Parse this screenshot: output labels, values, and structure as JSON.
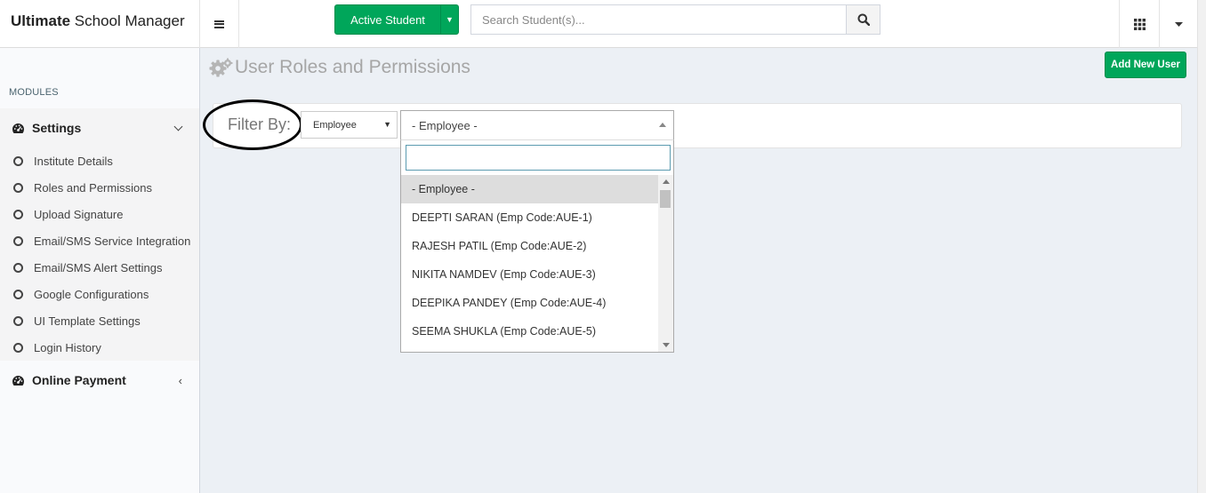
{
  "header": {
    "brand_bold": "Ultimate",
    "brand_rest": " School Manager",
    "active_student_label": "Active Student",
    "search_placeholder": "Search Student(s)..."
  },
  "sidebar": {
    "section_label": "MODULES",
    "settings_label": "Settings",
    "settings_items": [
      "Institute Details",
      "Roles and Permissions",
      "Upload Signature",
      "Email/SMS Service Integration",
      "Email/SMS Alert Settings",
      "Google Configurations",
      "UI Template Settings",
      "Login History"
    ],
    "online_payment_label": "Online Payment"
  },
  "main": {
    "page_title": "User Roles and Permissions",
    "add_user_label": "Add New User",
    "filter_label": "Filter By:",
    "filter_type_value": "Employee",
    "employee_select_value": "- Employee -",
    "dropdown_search_value": "",
    "dropdown_options": [
      "- Employee -",
      "DEEPTI SARAN (Emp Code:AUE-1)",
      "RAJESH PATIL (Emp Code:AUE-2)",
      "NIKITA NAMDEV (Emp Code:AUE-3)",
      "DEEPIKA PANDEY (Emp Code:AUE-4)",
      "SEEMA SHUKLA (Emp Code:AUE-5)"
    ],
    "dropdown_selected_index": 0
  },
  "colors": {
    "accent_green": "#00a65a",
    "content_bg": "#ecf0f5",
    "sidebar_bg": "#f9fafc"
  },
  "icons": {
    "menu": "hamburger-icon",
    "search": "search-icon",
    "apps": "grid-icon",
    "settings": "dashboard-icon",
    "title": "gears-icon"
  }
}
